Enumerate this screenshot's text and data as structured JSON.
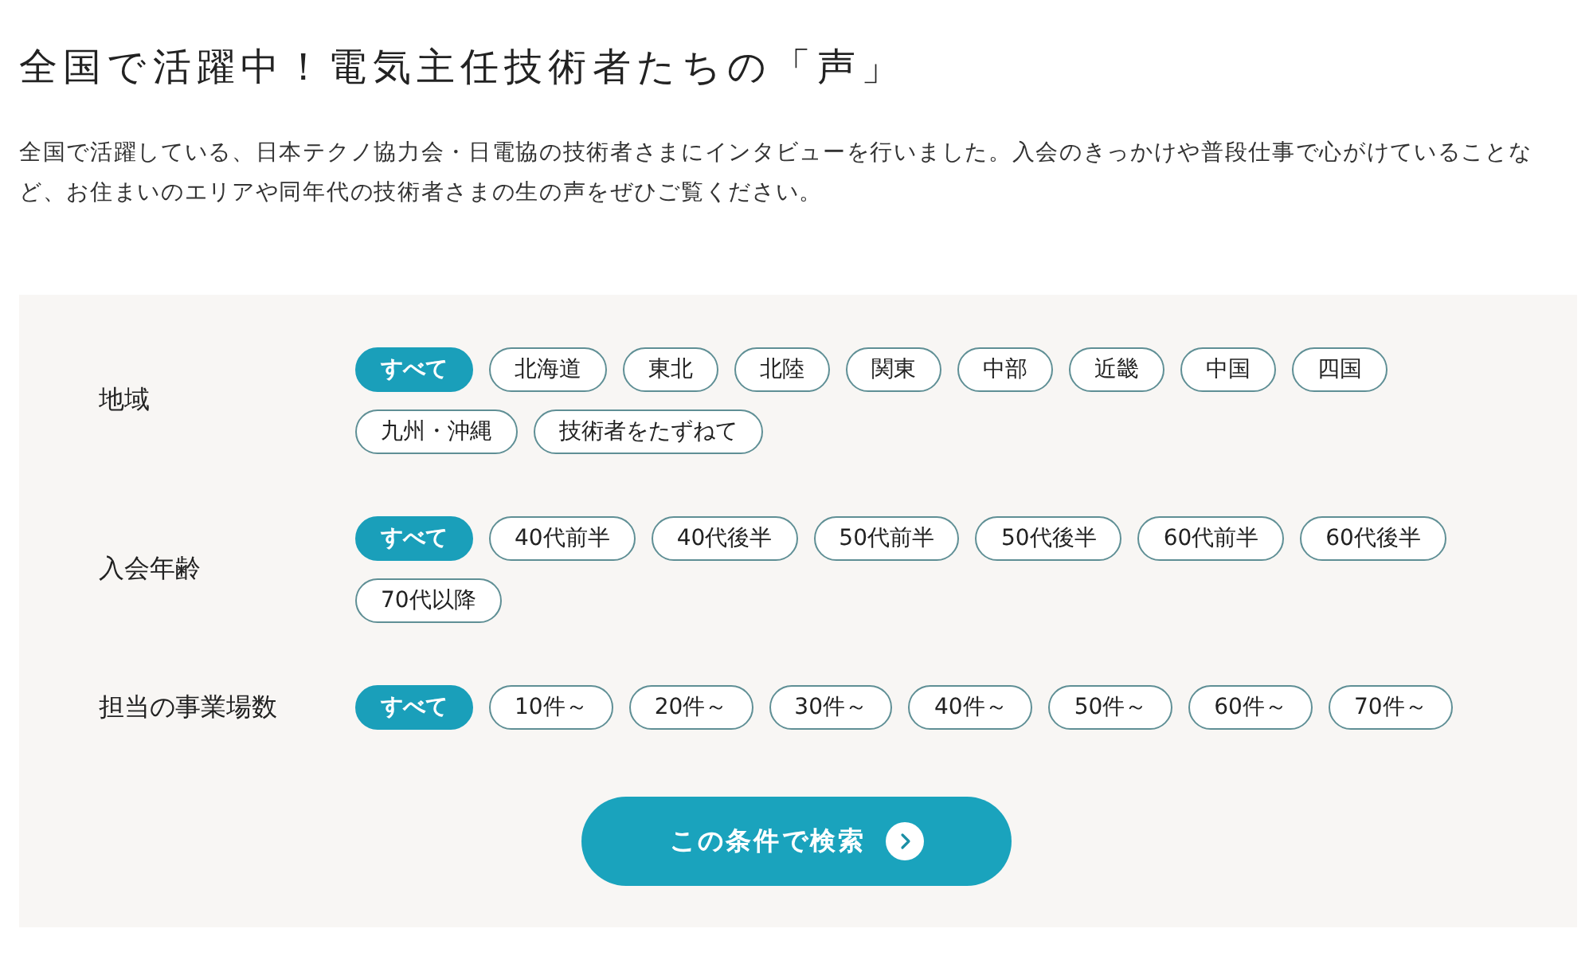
{
  "heading": "全国で活躍中！電気主任技術者たちの「声」",
  "intro": "全国で活躍している、日本テクノ協力会・日電協の技術者さまにインタビューを行いました。入会のきっかけや普段仕事で心がけていることなど、お住まいのエリアや同年代の技術者さまの生の声をぜひご覧ください。",
  "filters": [
    {
      "label": "地域",
      "options": [
        {
          "label": "すべて",
          "selected": true
        },
        {
          "label": "北海道",
          "selected": false
        },
        {
          "label": "東北",
          "selected": false
        },
        {
          "label": "北陸",
          "selected": false
        },
        {
          "label": "関東",
          "selected": false
        },
        {
          "label": "中部",
          "selected": false
        },
        {
          "label": "近畿",
          "selected": false
        },
        {
          "label": "中国",
          "selected": false
        },
        {
          "label": "四国",
          "selected": false
        },
        {
          "label": "九州・沖縄",
          "selected": false
        },
        {
          "label": "技術者をたずねて",
          "selected": false
        }
      ]
    },
    {
      "label": "入会年齢",
      "options": [
        {
          "label": "すべて",
          "selected": true
        },
        {
          "label": "40代前半",
          "selected": false
        },
        {
          "label": "40代後半",
          "selected": false
        },
        {
          "label": "50代前半",
          "selected": false
        },
        {
          "label": "50代後半",
          "selected": false
        },
        {
          "label": "60代前半",
          "selected": false
        },
        {
          "label": "60代後半",
          "selected": false
        },
        {
          "label": "70代以降",
          "selected": false
        }
      ]
    },
    {
      "label": "担当の事業場数",
      "options": [
        {
          "label": "すべて",
          "selected": true
        },
        {
          "label": "10件～",
          "selected": false
        },
        {
          "label": "20件～",
          "selected": false
        },
        {
          "label": "30件～",
          "selected": false
        },
        {
          "label": "40件～",
          "selected": false
        },
        {
          "label": "50件～",
          "selected": false
        },
        {
          "label": "60件～",
          "selected": false
        },
        {
          "label": "70件～",
          "selected": false
        }
      ]
    }
  ],
  "search_button": {
    "label": "この条件で検索"
  }
}
